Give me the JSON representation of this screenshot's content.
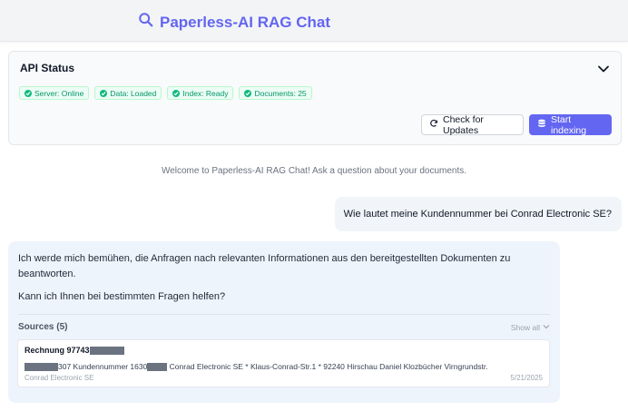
{
  "header": {
    "title": "Paperless-AI RAG Chat"
  },
  "status": {
    "title": "API Status",
    "badges": [
      {
        "label": "Server: Online"
      },
      {
        "label": "Data: Loaded"
      },
      {
        "label": "Index: Ready"
      },
      {
        "label": "Documents: 25"
      }
    ],
    "check_updates_label": "Check for Updates",
    "start_indexing_label": "Start indexing"
  },
  "chat": {
    "welcome": "Welcome to Paperless-AI RAG Chat! Ask a question about your documents.",
    "user_message": "Wie lautet meine Kundennummer bei Conrad Electronic SE?",
    "bot_paragraph_1": "Ich werde mich bemühen, die Anfragen nach relevanten Informationen aus den bereitgestellten Dokumenten zu beantworten.",
    "bot_paragraph_2": "Kann ich Ihnen bei bestimmten Fragen helfen?",
    "sources_title": "Sources (5)",
    "show_all_label": "Show all",
    "source": {
      "title_prefix": "Rechnung 97743",
      "snippet_part_1": "307 Kundennummer 1630",
      "snippet_part_2": " Conrad Electronic SE * Klaus-Conrad-Str.1 * 92240 Hirschau Daniel Klozbücher Virngrundstr.",
      "correspondent": "Conrad Electronic SE",
      "date": "5/21/2025"
    }
  },
  "colors": {
    "accent": "#6366f1",
    "success": "#10b981",
    "bot_bubble": "#eef4fb",
    "user_bubble": "#f1f5f9"
  }
}
